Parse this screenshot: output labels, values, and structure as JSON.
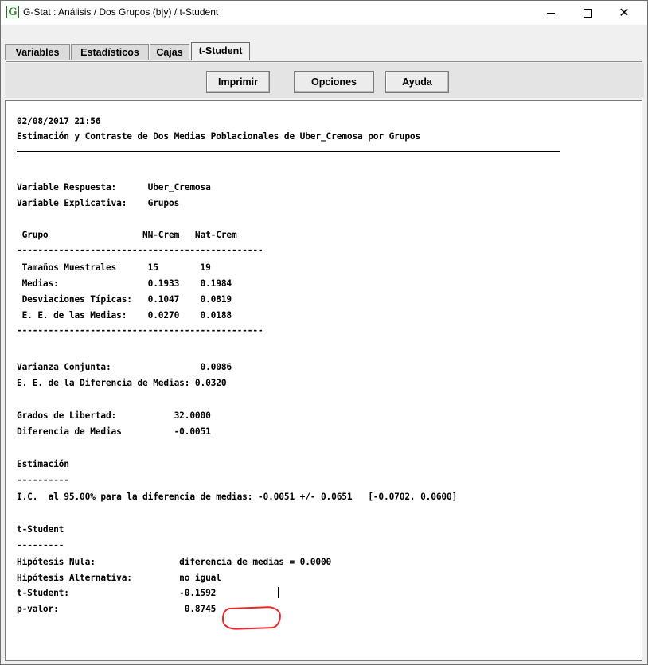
{
  "window": {
    "title": "G-Stat : Análisis / Dos Grupos (b|y) / t-Student",
    "app_icon_letter": "G",
    "controls": {
      "minimize": "minimize-icon",
      "maximize": "maximize-icon",
      "close": "✕"
    }
  },
  "tabs": [
    {
      "label": "Variables",
      "active": false
    },
    {
      "label": "Estadísticos",
      "active": false
    },
    {
      "label": "Cajas",
      "active": false
    },
    {
      "label": "t-Student",
      "active": true
    }
  ],
  "toolbar": {
    "print_label": "Imprimir",
    "options_label": "Opciones",
    "help_label": "Ayuda"
  },
  "report": {
    "lines": [
      "02/08/2017 21:56",
      "Estimación y Contraste de Dos Medias Poblacionales de Uber_Cremosa por Grupos",
      "Variable Respuesta:      Uber_Cremosa",
      "Variable Explicativa:    Grupos",
      " Grupo                  NN-Crem   Nat-Crem",
      "-----------------------------------------------",
      " Tamaños Muestrales      15        19",
      " Medias:                 0.1933    0.1984",
      " Desviaciones Típicas:   0.1047    0.0819",
      " E. E. de las Medias:    0.0270    0.0188",
      "-----------------------------------------------",
      "Varianza Conjunta:                 0.0086",
      "E. E. de la Diferencia de Medias: 0.0320",
      "Grados de Libertad:           32.0000",
      "Diferencia de Medias          -0.0051",
      "Estimación",
      "----------",
      "I.C.  al 95.00% para la diferencia de medias: -0.0051 +/- 0.0651   [-0.0702, 0.0600]",
      "t-Student",
      "---------",
      "Hipótesis Nula:                diferencia de medias = 0.0000",
      "Hipótesis Alternativa:         no igual",
      "t-Student:                     -0.1592",
      "p-valor:                        0.8745"
    ]
  },
  "annotation": {
    "stroke_color": "#e8262b",
    "shape": "hand-drawn-circle"
  }
}
